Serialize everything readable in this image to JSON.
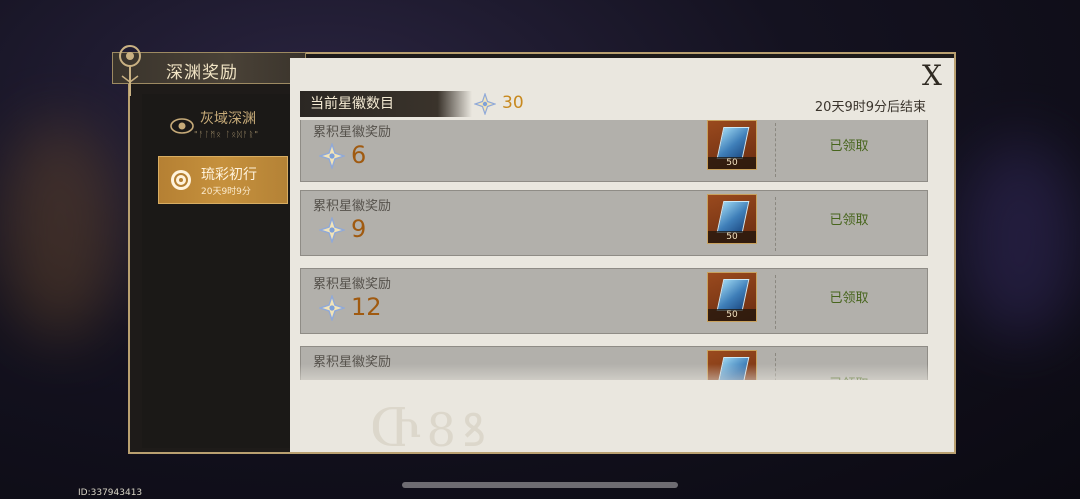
{
  "header": {
    "title": "深渊奖励"
  },
  "close": {
    "glyph": "X"
  },
  "sidebar": {
    "tabs": [
      {
        "label": "灰域深渊",
        "sub": "\"ᚨᛚᛗᛟ ᛚᛟᛞᚨᚱ\""
      },
      {
        "label": "琉彩初行",
        "sub": "20天9时9分"
      }
    ]
  },
  "status": {
    "current_label": "当前星徽数目",
    "current_count": "30",
    "timer": "20天9时9分后结束"
  },
  "rewards": [
    {
      "label": "累积星徽奖励",
      "count": "6",
      "item_qty": "50",
      "state": "已领取"
    },
    {
      "label": "累积星徽奖励",
      "count": "9",
      "item_qty": "50",
      "state": "已领取"
    },
    {
      "label": "累积星徽奖励",
      "count": "12",
      "item_qty": "50",
      "state": "已领取"
    },
    {
      "label": "累积星徽奖励",
      "count": "",
      "item_qty": "",
      "state": "已领取"
    }
  ],
  "footer": {
    "uid": "ID:337943413"
  },
  "colors": {
    "accent": "#c8891e",
    "claimed": "#47651c",
    "active_tab": "#c6913d"
  }
}
